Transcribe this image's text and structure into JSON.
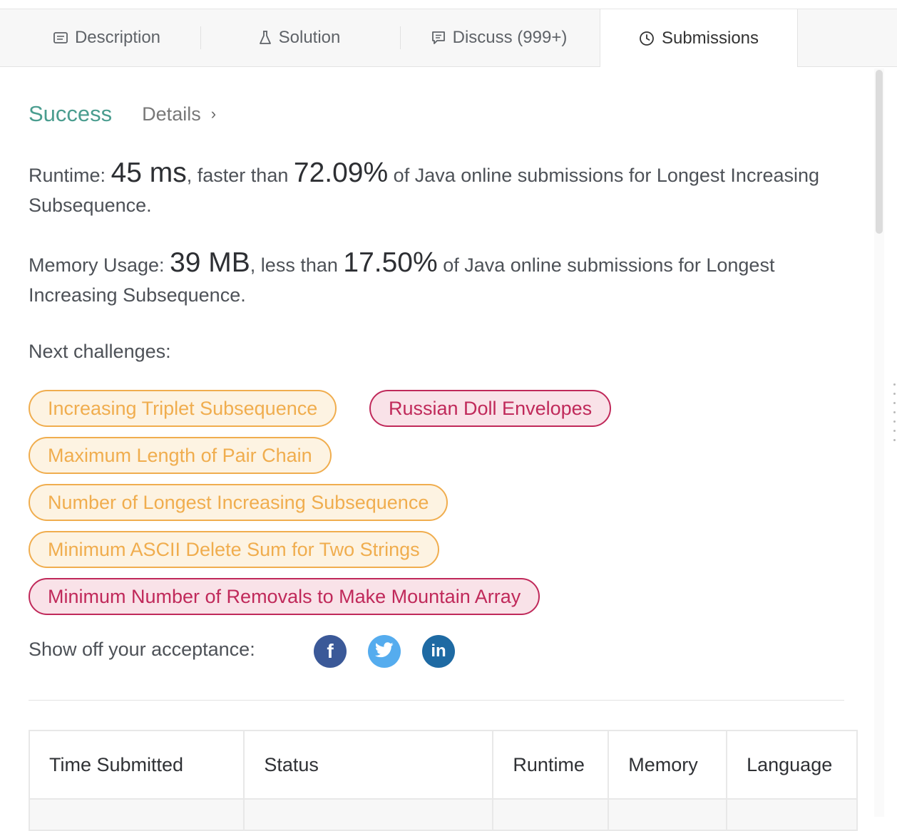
{
  "tabs": [
    {
      "label": "Description",
      "icon": "description-icon"
    },
    {
      "label": "Solution",
      "icon": "flask-icon"
    },
    {
      "label": "Discuss (999+)",
      "icon": "comment-icon"
    },
    {
      "label": "Submissions",
      "icon": "clock-icon",
      "active": true
    }
  ],
  "result": {
    "status": "Success",
    "details_label": "Details",
    "details_chevron": "›"
  },
  "runtime": {
    "label": "Runtime:",
    "value": "45 ms",
    "comparison": ", faster than",
    "percent": "72.09%",
    "suffix": "of Java online submissions for Longest Increasing Subsequence."
  },
  "memory": {
    "label": "Memory Usage:",
    "value": "39 MB",
    "comparison": ", less than",
    "percent": "17.50%",
    "suffix": "of Java online submissions for Longest Increasing Subsequence."
  },
  "next_challenges": {
    "label": "Next challenges:",
    "items": [
      {
        "label": "Increasing Triplet Subsequence",
        "difficulty": "medium"
      },
      {
        "label": "Russian Doll Envelopes",
        "difficulty": "hard"
      },
      {
        "label": "Maximum Length of Pair Chain",
        "difficulty": "medium"
      },
      {
        "label": "Number of Longest Increasing Subsequence",
        "difficulty": "medium"
      },
      {
        "label": "Minimum ASCII Delete Sum for Two Strings",
        "difficulty": "medium"
      },
      {
        "label": "Minimum Number of Removals to Make Mountain Array",
        "difficulty": "hard"
      }
    ]
  },
  "share": {
    "label": "Show off your acceptance:",
    "buttons": [
      {
        "name": "facebook",
        "glyph": "f",
        "color": "#3b5998"
      },
      {
        "name": "twitter",
        "glyph": "twitter-bird",
        "color": "#55acee"
      },
      {
        "name": "linkedin",
        "glyph": "in",
        "color": "#1e6aa3"
      }
    ]
  },
  "table": {
    "headers": [
      "Time Submitted",
      "Status",
      "Runtime",
      "Memory",
      "Language"
    ]
  },
  "colors": {
    "success": "#4a9d8f",
    "medium": "#f0ad4e",
    "hard": "#c0295a"
  }
}
